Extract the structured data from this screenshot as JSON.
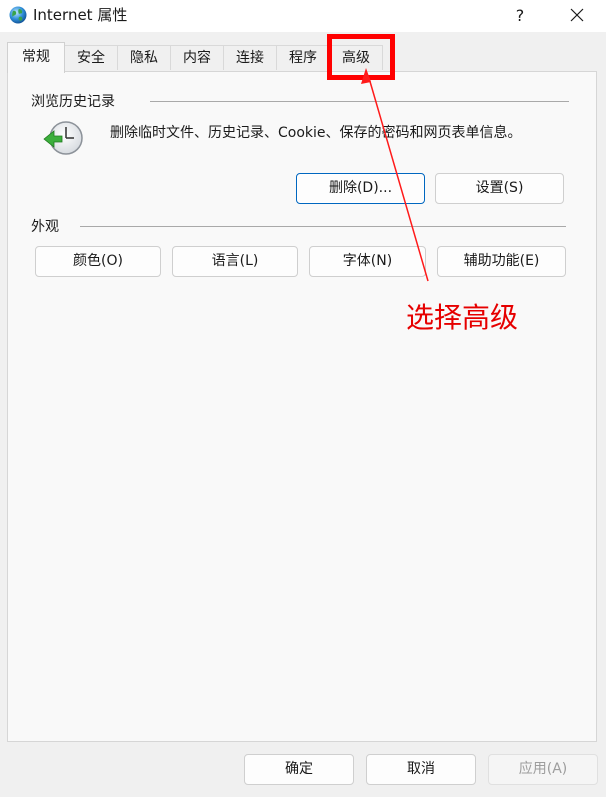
{
  "window": {
    "title": "Internet 属性",
    "help_label": "?",
    "close_label": "✕"
  },
  "tabs": [
    {
      "label": "常规",
      "active": true
    },
    {
      "label": "安全",
      "active": false
    },
    {
      "label": "隐私",
      "active": false
    },
    {
      "label": "内容",
      "active": false
    },
    {
      "label": "连接",
      "active": false
    },
    {
      "label": "程序",
      "active": false
    },
    {
      "label": "高级",
      "active": false
    }
  ],
  "browsing_history": {
    "group_label": "浏览历史记录",
    "description": "删除临时文件、历史记录、Cookie、保存的密码和网页表单信息。",
    "delete_label": "删除(D)...",
    "settings_label": "设置(S)"
  },
  "appearance": {
    "group_label": "外观",
    "colors_label": "颜色(O)",
    "languages_label": "语言(L)",
    "fonts_label": "字体(N)",
    "accessibility_label": "辅助功能(E)"
  },
  "annotation": {
    "text": "选择高级",
    "color": "#e60000"
  },
  "footer": {
    "ok_label": "确定",
    "cancel_label": "取消",
    "apply_label": "应用(A)"
  },
  "colors": {
    "accent": "#0067c0",
    "highlight": "#ff0000"
  }
}
